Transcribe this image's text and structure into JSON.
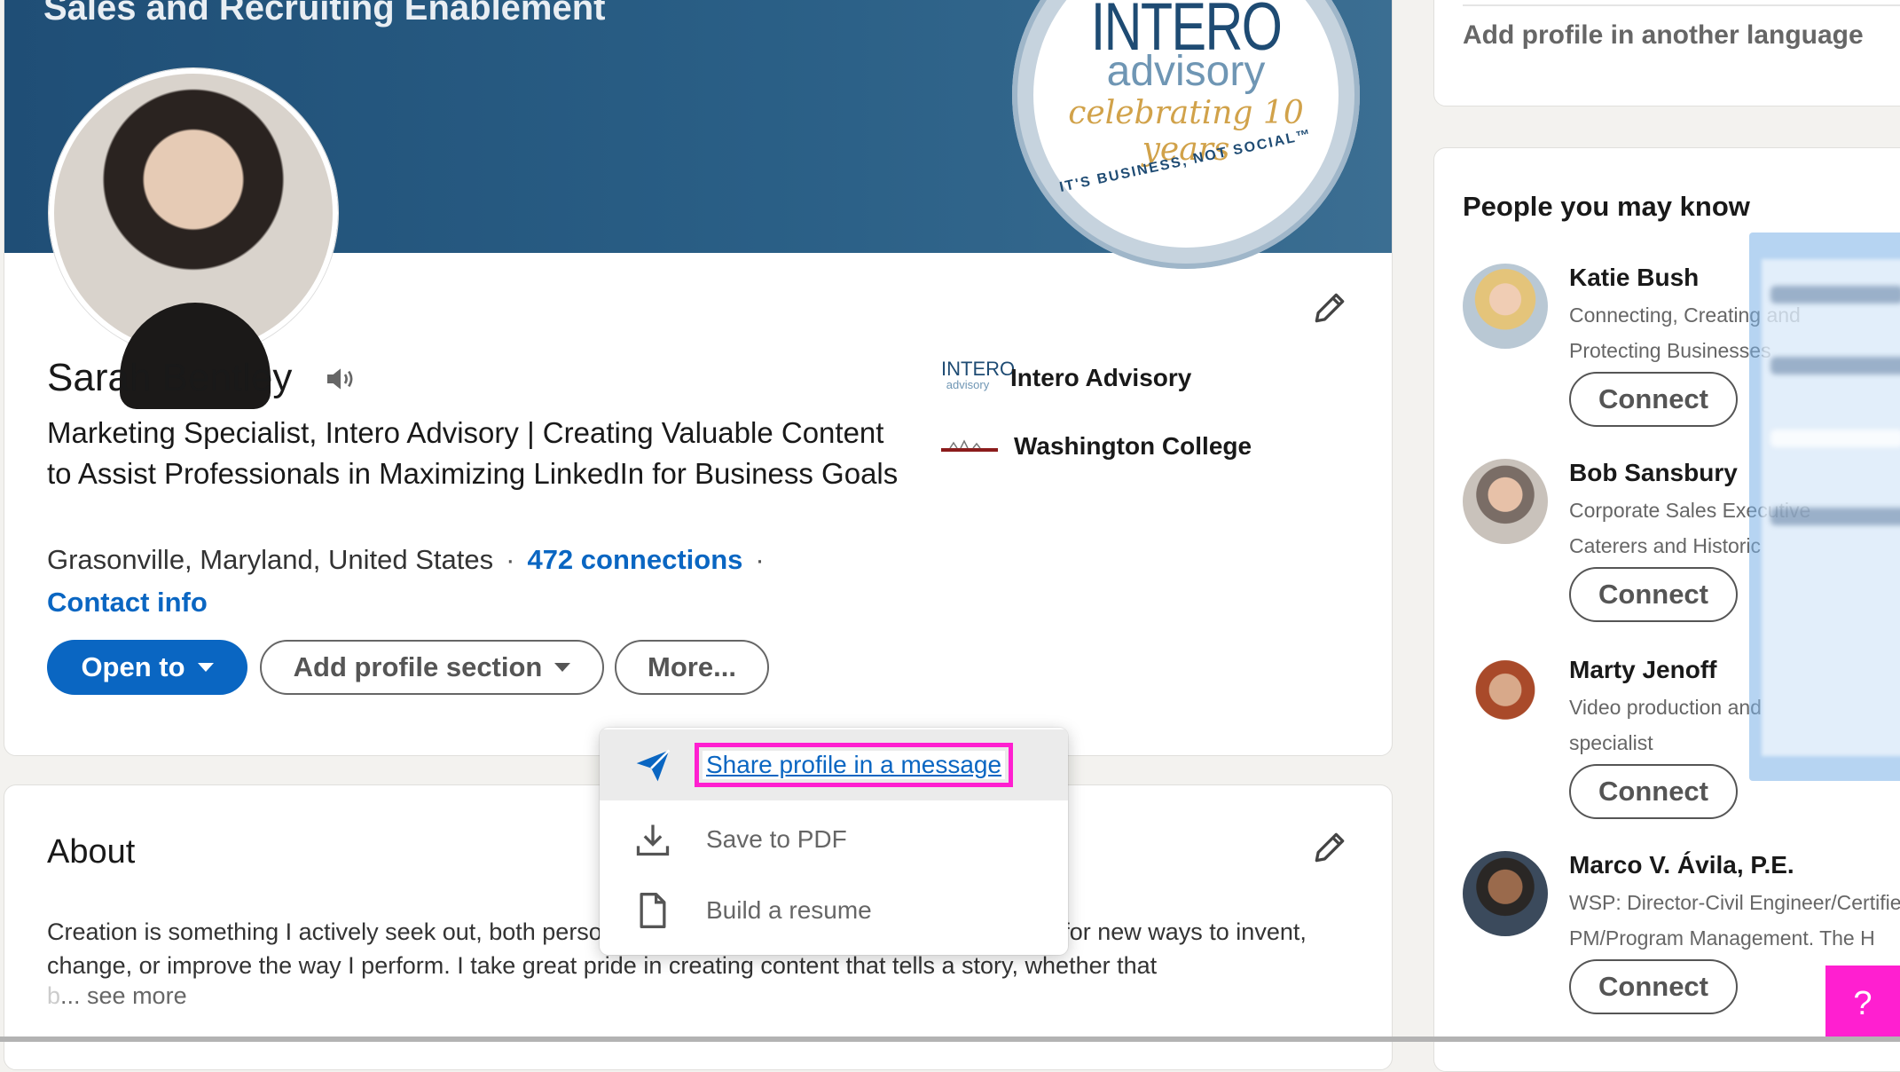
{
  "profile": {
    "banner_title": "Sales and Recruiting Enablement",
    "banner_logo": {
      "word1": "INTERO",
      "word2": "advisory",
      "script": "celebrating 10 years",
      "tagline": "IT'S BUSINESS, NOT SOCIAL™"
    },
    "name": "Sarah Bentley",
    "headline": "Marketing Specialist, Intero Advisory | Creating Valuable Content to Assist Professionals in Maximizing LinkedIn for Business Goals",
    "location": "Grasonville, Maryland, United States",
    "separator": "·",
    "connections": "472 connections",
    "contact_info": "Contact info",
    "buttons": {
      "open_to": "Open to",
      "add_section": "Add profile section",
      "more": "More..."
    },
    "experience": [
      {
        "logo_text": "INTERO",
        "logo_sub": "advisory",
        "name": "Intero Advisory"
      },
      {
        "name": "Washington College"
      }
    ]
  },
  "more_menu": {
    "items": [
      {
        "label": "Share profile in a message",
        "icon": "send-icon"
      },
      {
        "label": "Save to PDF",
        "icon": "download-icon"
      },
      {
        "label": "Build a resume",
        "icon": "document-icon"
      }
    ]
  },
  "about": {
    "title": "About",
    "text": "Creation is something I actively seek out, both personally and professionally. I'm always looking for new ways to invent, change, or improve the way I perform. I take great pride in creating content that tells a story, whether that",
    "truncated_char": "b",
    "see_more": "... see more"
  },
  "right_rail": {
    "language_link": "Add profile in another language",
    "pymk_title": "People you may know",
    "people": [
      {
        "name": "Katie Bush",
        "line1": "Connecting, Creating and",
        "line2": "Protecting Businesses",
        "connect": "Connect"
      },
      {
        "name": "Bob Sansbury",
        "line1": "Corporate Sales Executive",
        "line2": "Caterers and Historic",
        "connect": "Connect"
      },
      {
        "name": "Marty Jenoff",
        "line1": "Video production and",
        "line2": "specialist",
        "connect": "Connect"
      },
      {
        "name": "Marco V. Ávila, P.E.",
        "line1": "WSP: Director-Civil Engineer/Certified",
        "line2": "PM/Program Management. The H",
        "connect": "Connect"
      }
    ]
  },
  "help": {
    "label": "?"
  },
  "colors": {
    "brand_blue": "#0a66c2",
    "highlight_magenta": "#ff1fd0",
    "banner": "#1f4e76"
  }
}
